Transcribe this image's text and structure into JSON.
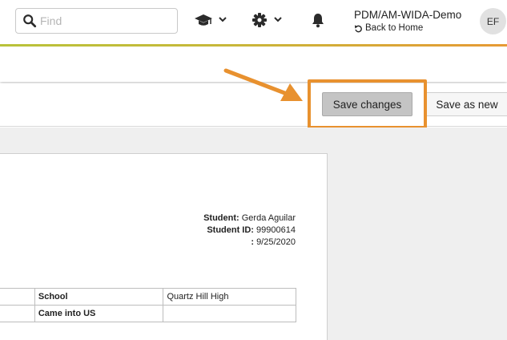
{
  "header": {
    "search": {
      "placeholder": "Find",
      "value": ""
    },
    "icons": [
      "search-icon",
      "graduation-cap-icon",
      "chevron-down-icon",
      "gear-icon",
      "chevron-down-icon",
      "bell-icon"
    ],
    "org_name": "PDM/AM-WIDA-Demo",
    "back_home": "Back to Home",
    "avatar_initials": "EF",
    "accent_gradient": [
      "#b9c33a",
      "#e79a35"
    ]
  },
  "toolbar": {
    "save_changes": "Save changes",
    "save_as_new": "Save as new",
    "highlight_color": "#e8912f"
  },
  "document": {
    "student_label": "Student:",
    "student_value": "Gerda Aguilar",
    "student_id_label": "Student ID:",
    "student_id_value": "99900614",
    "date_label": ":",
    "date_value": "9/25/2020",
    "table": [
      {
        "field": "School",
        "value": "Quartz Hill High"
      },
      {
        "field": "Came into US",
        "value": ""
      }
    ]
  }
}
